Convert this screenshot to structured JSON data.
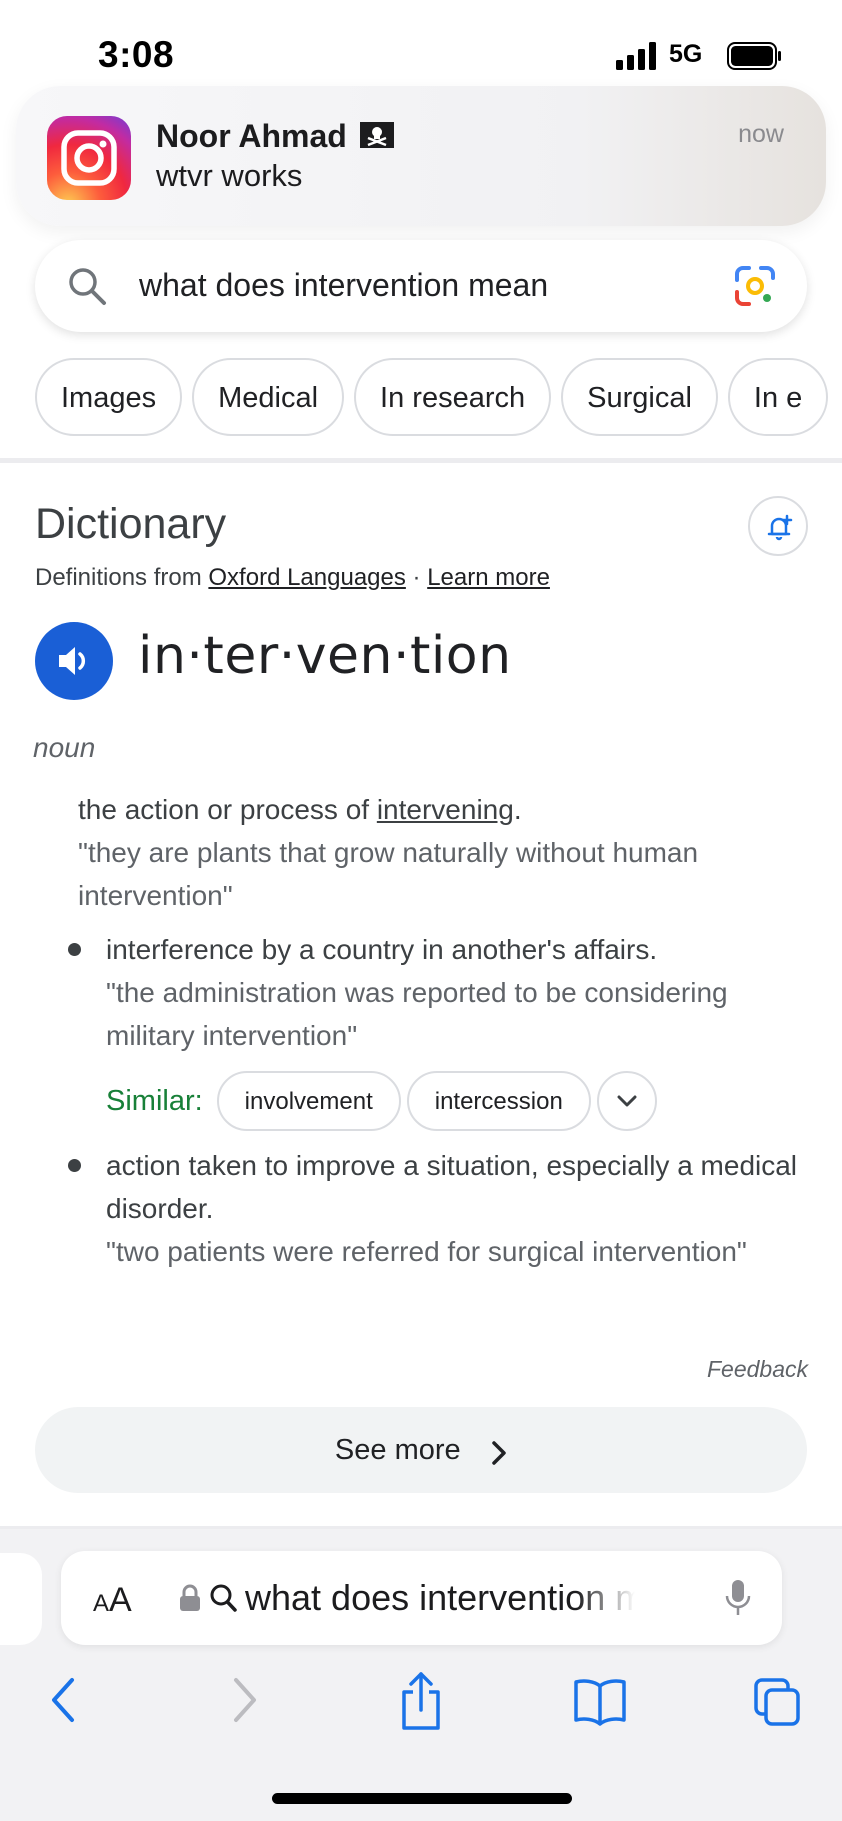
{
  "status_bar": {
    "time": "3:08",
    "network": "5G"
  },
  "notification": {
    "app_icon": "instagram-icon",
    "title": "Noor Ahmad",
    "body": "wtvr works",
    "time": "now"
  },
  "search": {
    "query": "what does intervention mean",
    "icon": "search-icon",
    "lens_icon": "google-lens-icon"
  },
  "chips": [
    "Images",
    "Medical",
    "In research",
    "Surgical",
    "In e"
  ],
  "dictionary": {
    "title": "Dictionary",
    "source_prefix": "Definitions from ",
    "source_link": "Oxford Languages",
    "separator": " · ",
    "learn_more": "Learn more",
    "headword": "in·ter·ven·tion",
    "part_of_speech": "noun",
    "definitions": [
      {
        "pre": "the action or process of ",
        "link": "intervening",
        "post": ".",
        "example": "\"they are plants that grow naturally without human intervention\""
      },
      {
        "text": "interference by a country in another's affairs.",
        "example": "\"the administration was reported to be considering military intervention\""
      },
      {
        "text": "action taken to improve a situation, especially a medical disorder.",
        "example": "\"two patients were referred for surgical intervention\""
      }
    ],
    "similar_label": "Similar:",
    "similar": [
      "involvement",
      "intercession"
    ],
    "feedback": "Feedback",
    "see_more": "See more"
  },
  "browser": {
    "text_size_label_big": "A",
    "text_size_label_small": "A",
    "url_text": "what does intervention mean"
  },
  "colors": {
    "accent_blue": "#1a5fd6",
    "similar_green": "#188038",
    "safari_blue": "#1a73e8"
  }
}
